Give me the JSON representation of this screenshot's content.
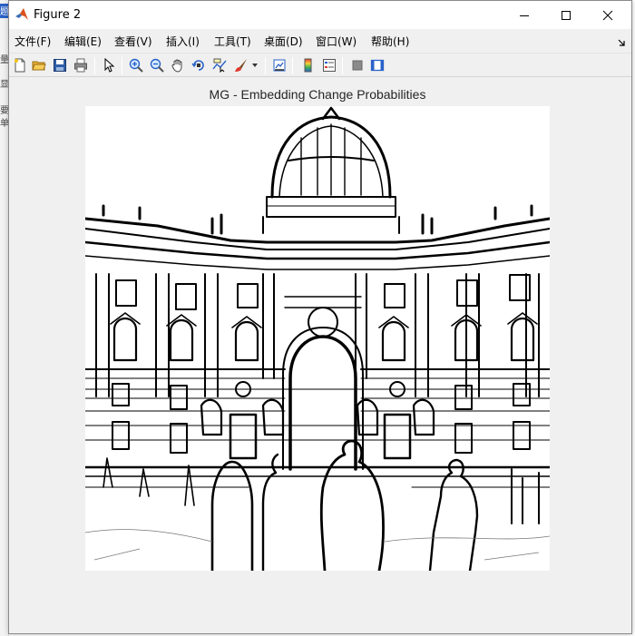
{
  "window": {
    "title": "Figure 2"
  },
  "menu": [
    {
      "label": "文件(F)"
    },
    {
      "label": "编辑(E)"
    },
    {
      "label": "查看(V)"
    },
    {
      "label": "插入(I)"
    },
    {
      "label": "工具(T)"
    },
    {
      "label": "桌面(D)"
    },
    {
      "label": "窗口(W)"
    },
    {
      "label": "帮助(H)"
    }
  ],
  "toolbar": {
    "icons": [
      "new-figure-icon",
      "open-file-icon",
      "save-icon",
      "print-icon",
      "pointer-icon",
      "zoom-in-icon",
      "zoom-out-icon",
      "pan-hand-icon",
      "rotate-3d-icon",
      "data-cursor-icon",
      "brush-icon",
      "brush-dropdown-icon",
      "link-plot-icon",
      "colorbar-icon",
      "legend-icon",
      "hide-plot-tools-icon",
      "show-plot-tools-icon"
    ]
  },
  "plot": {
    "title": "MG - Embedding Change Probabilities",
    "image_content": "grayscale edge-map image of a baroque palace facade with a domed roof and pedestrians in front"
  },
  "background": {
    "chars": [
      "题",
      "量",
      "显",
      "要",
      "单"
    ]
  },
  "colors": {
    "titlebar": "#ffffff",
    "chrome": "#f0f0f0",
    "axes_bg": "#ffffff",
    "ink": "#000000"
  }
}
